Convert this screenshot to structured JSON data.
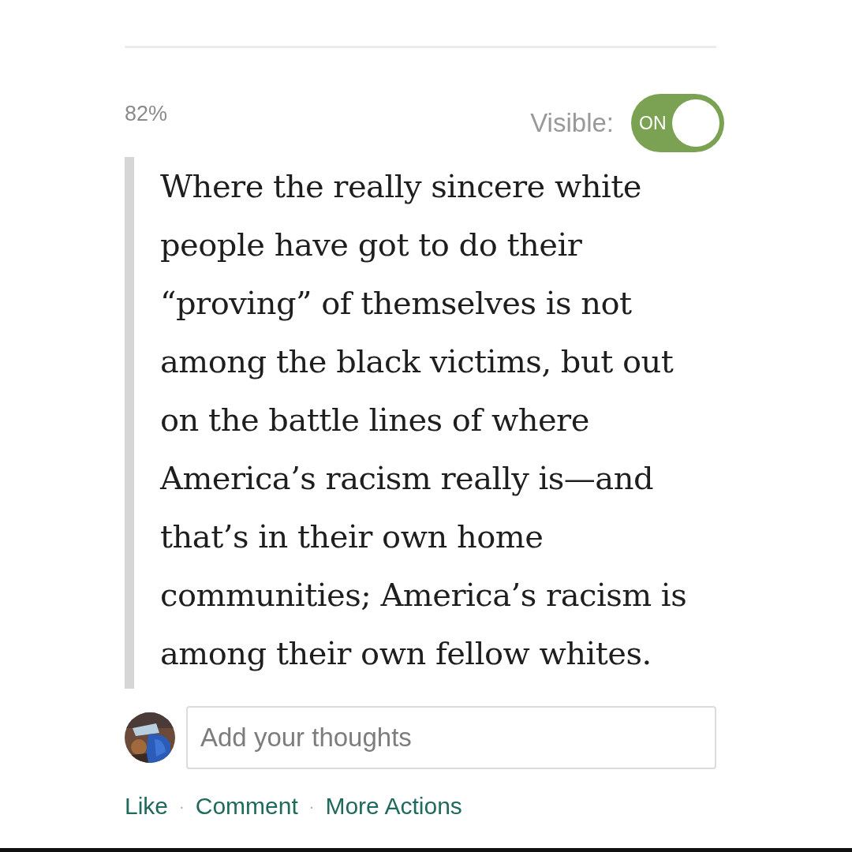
{
  "progress": "82%",
  "visibility": {
    "label": "Visible:",
    "on": true,
    "toggle_text": "ON"
  },
  "highlight": {
    "text": "Where the really sincere white people have got to do their “proving” of themselves is not among the black victims, but out on the battle lines of where America’s racism really is—and that’s in their own home communities; America’s racism is among their own fellow whites."
  },
  "comment_box": {
    "placeholder": "Add your thoughts"
  },
  "actions": [
    {
      "label": "Like"
    },
    {
      "label": "Comment"
    },
    {
      "label": "More Actions"
    }
  ],
  "separator": "·"
}
